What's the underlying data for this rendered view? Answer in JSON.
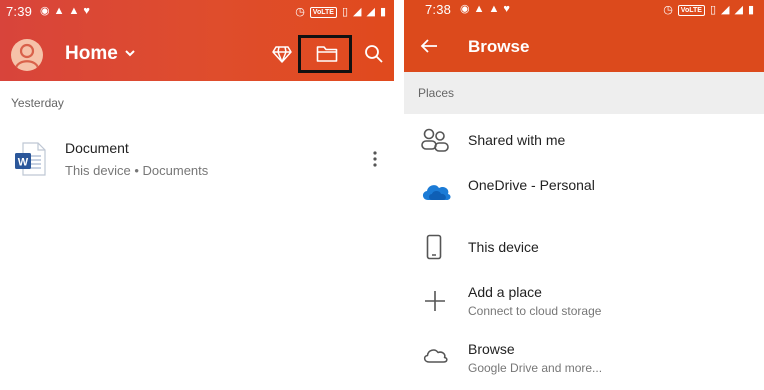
{
  "left": {
    "status": {
      "time": "7:39"
    },
    "header": {
      "title": "Home"
    },
    "section": "Yesterday",
    "document": {
      "name": "Document",
      "subtitle": "This device • Documents"
    }
  },
  "right": {
    "status": {
      "time": "7:38"
    },
    "header": {
      "title": "Browse"
    },
    "section": "Places",
    "items": [
      {
        "label": "Shared with me",
        "icon": "people-icon"
      },
      {
        "label": "OneDrive - Personal",
        "icon": "onedrive-cloud-icon"
      },
      {
        "label": "This device",
        "icon": "phone-icon"
      },
      {
        "label": "Add a place",
        "sub": "Connect to cloud storage",
        "icon": "plus-icon"
      },
      {
        "label": "Browse",
        "sub": "Google Drive and more...",
        "icon": "cloud-icon"
      }
    ]
  },
  "colors": {
    "accent": "#dc4a1c",
    "onedrive": "#1b7bd6",
    "word": "#2b579a"
  }
}
